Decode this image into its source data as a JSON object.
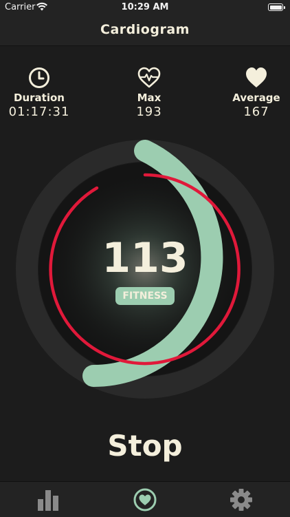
{
  "status_bar": {
    "carrier": "Carrier",
    "time": "10:29 AM",
    "wifi_icon": "wifi-icon",
    "battery_icon": "battery-icon"
  },
  "nav": {
    "title": "Cardiogram"
  },
  "stats": [
    {
      "icon": "clock-icon",
      "label": "Duration",
      "value": "01:17:31"
    },
    {
      "icon": "heartbeat-icon",
      "label": "Max",
      "value": "193"
    },
    {
      "icon": "heart-icon",
      "label": "Average",
      "value": "167"
    }
  ],
  "gauge": {
    "value": "113",
    "zone_label": "FITNESS",
    "outer_arc_color": "#9ccdb0",
    "inner_arc_color": "#e0193a",
    "track_color": "#2a2a2a"
  },
  "stop_label": "Stop",
  "tabs": [
    {
      "icon": "bar-chart-icon",
      "active": false
    },
    {
      "icon": "heart-circle-icon",
      "active": true
    },
    {
      "icon": "gear-icon",
      "active": false
    }
  ],
  "colors": {
    "accent": "#9ccdb0",
    "heart_rate": "#e0193a",
    "text": "#f4efdc",
    "background": "#1c1c1c",
    "inactive_icon": "#8a8a8a"
  }
}
